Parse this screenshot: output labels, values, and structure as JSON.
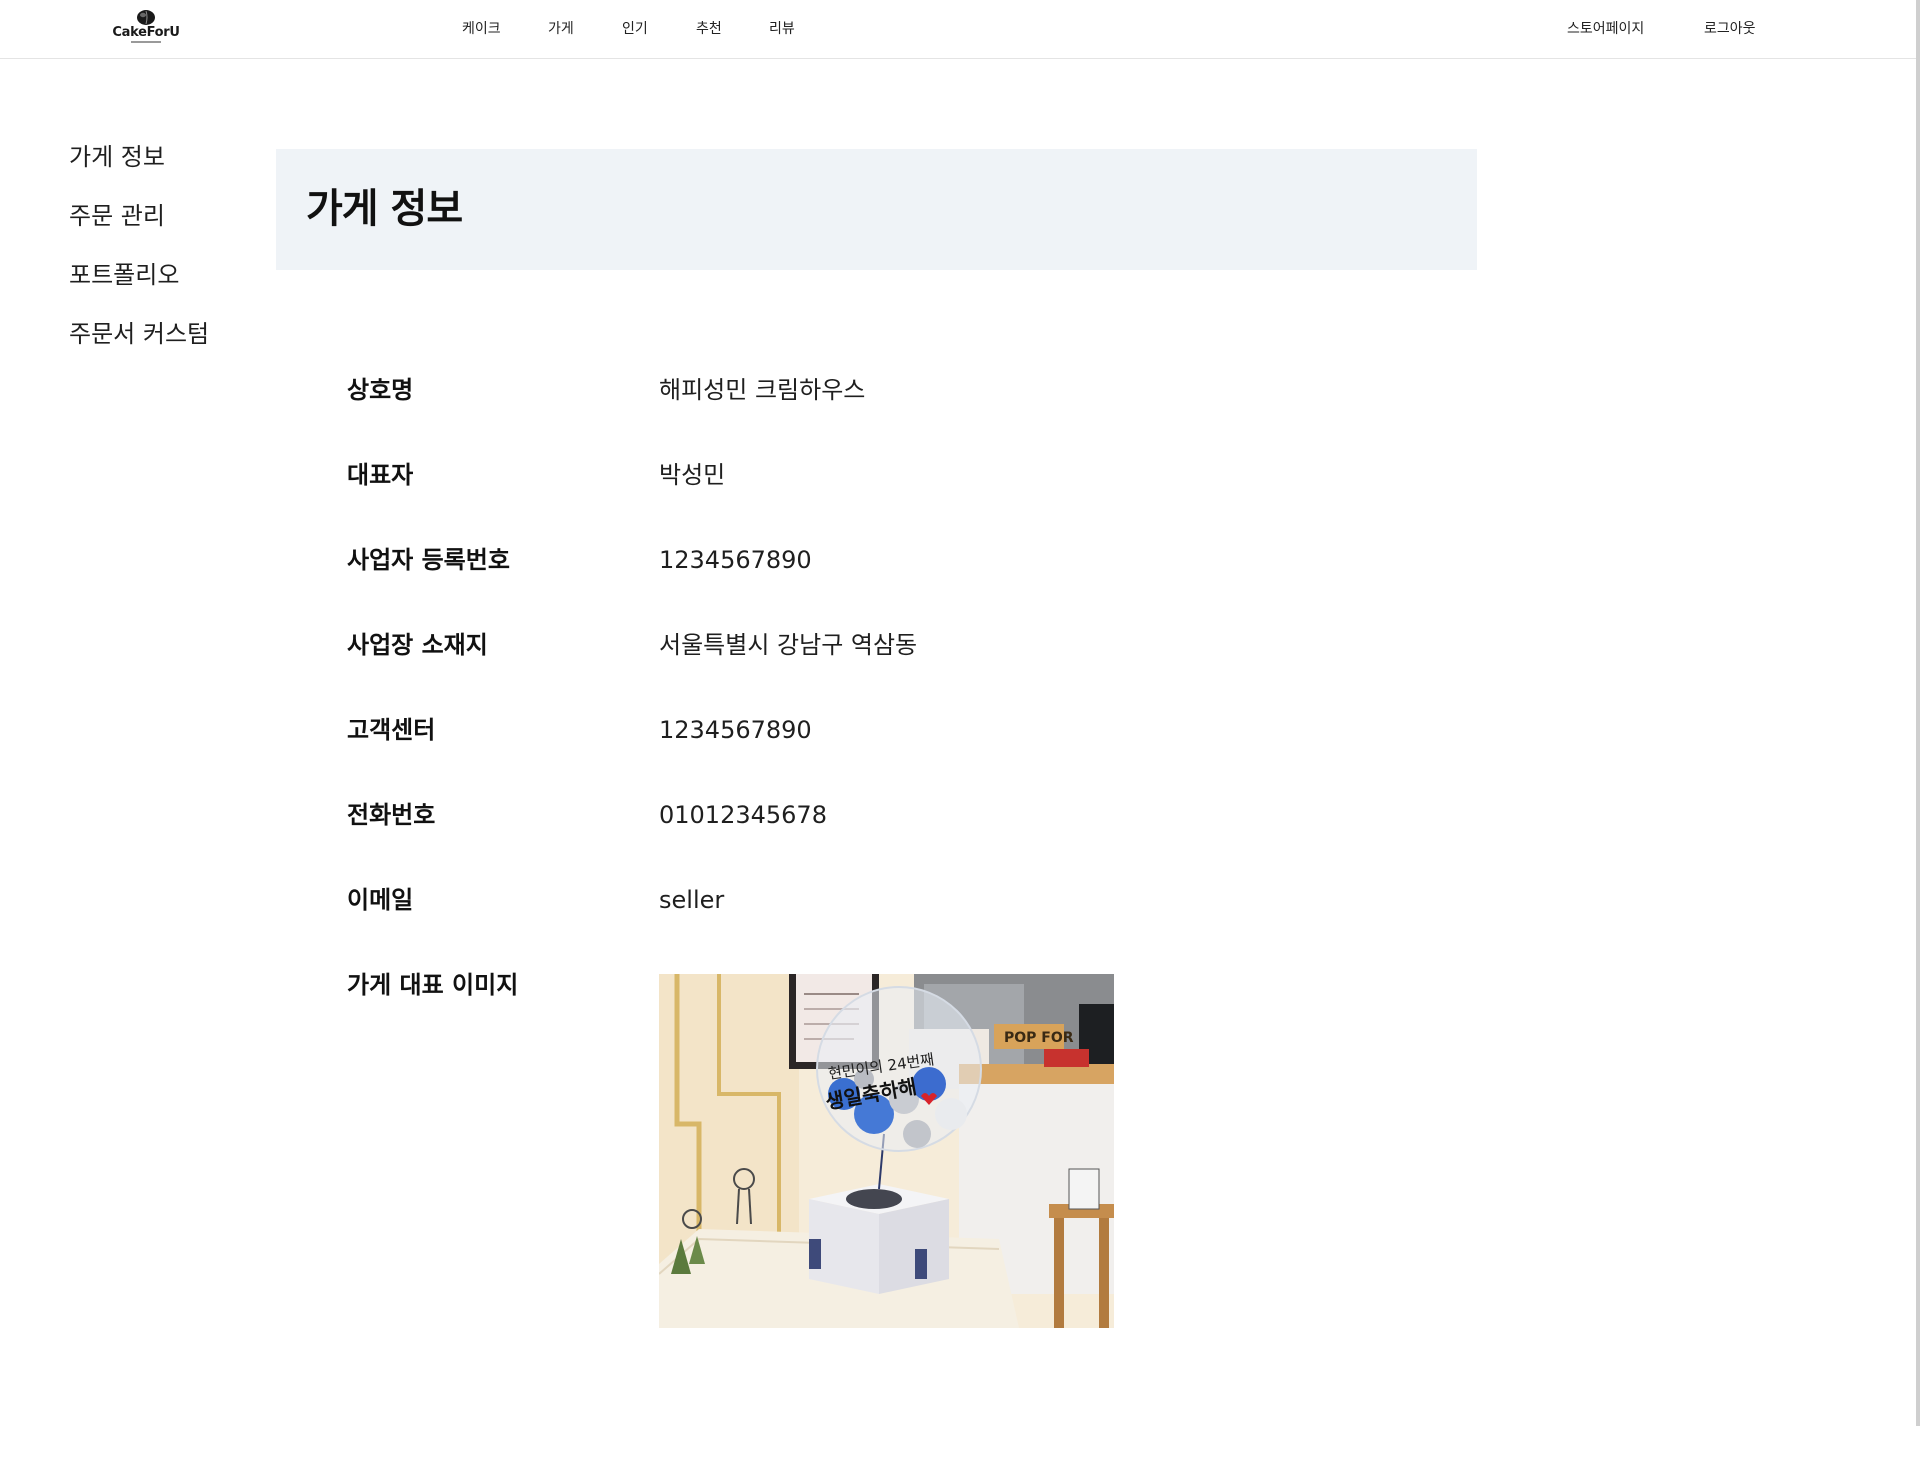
{
  "brand": {
    "logo_text": "CakeForU",
    "logo_icon": "cake-icon"
  },
  "topnav": {
    "items": [
      "케이크",
      "가게",
      "인기",
      "추천",
      "리뷰"
    ],
    "store_page": "스토어페이지",
    "logout": "로그아웃"
  },
  "sidebar": {
    "items": [
      "가게 정보",
      "주문 관리",
      "포트폴리오",
      "주문서 커스텀"
    ]
  },
  "page": {
    "title": "가게 정보"
  },
  "store_info": [
    {
      "label": "상호명",
      "value": "해피성민 크림하우스"
    },
    {
      "label": "대표자",
      "value": "박성민"
    },
    {
      "label": "사업자 등록번호",
      "value": "1234567890"
    },
    {
      "label": "사업장 소재지",
      "value": "서울특별시 강남구 역삼동"
    },
    {
      "label": "고객센터",
      "value": "1234567890"
    },
    {
      "label": "전화번호",
      "value": "01012345678"
    },
    {
      "label": "이메일",
      "value": "seller"
    },
    {
      "label": "가게 대표 이미지",
      "value": ""
    }
  ],
  "image": {
    "balloon_text_line1": "현민이의 24번째",
    "balloon_text_line2": "생일축하해",
    "sign_text": "POP FOR"
  },
  "colors": {
    "header_panel": "#eff3f7",
    "divider": "#e4e4e4",
    "text": "#111111"
  }
}
